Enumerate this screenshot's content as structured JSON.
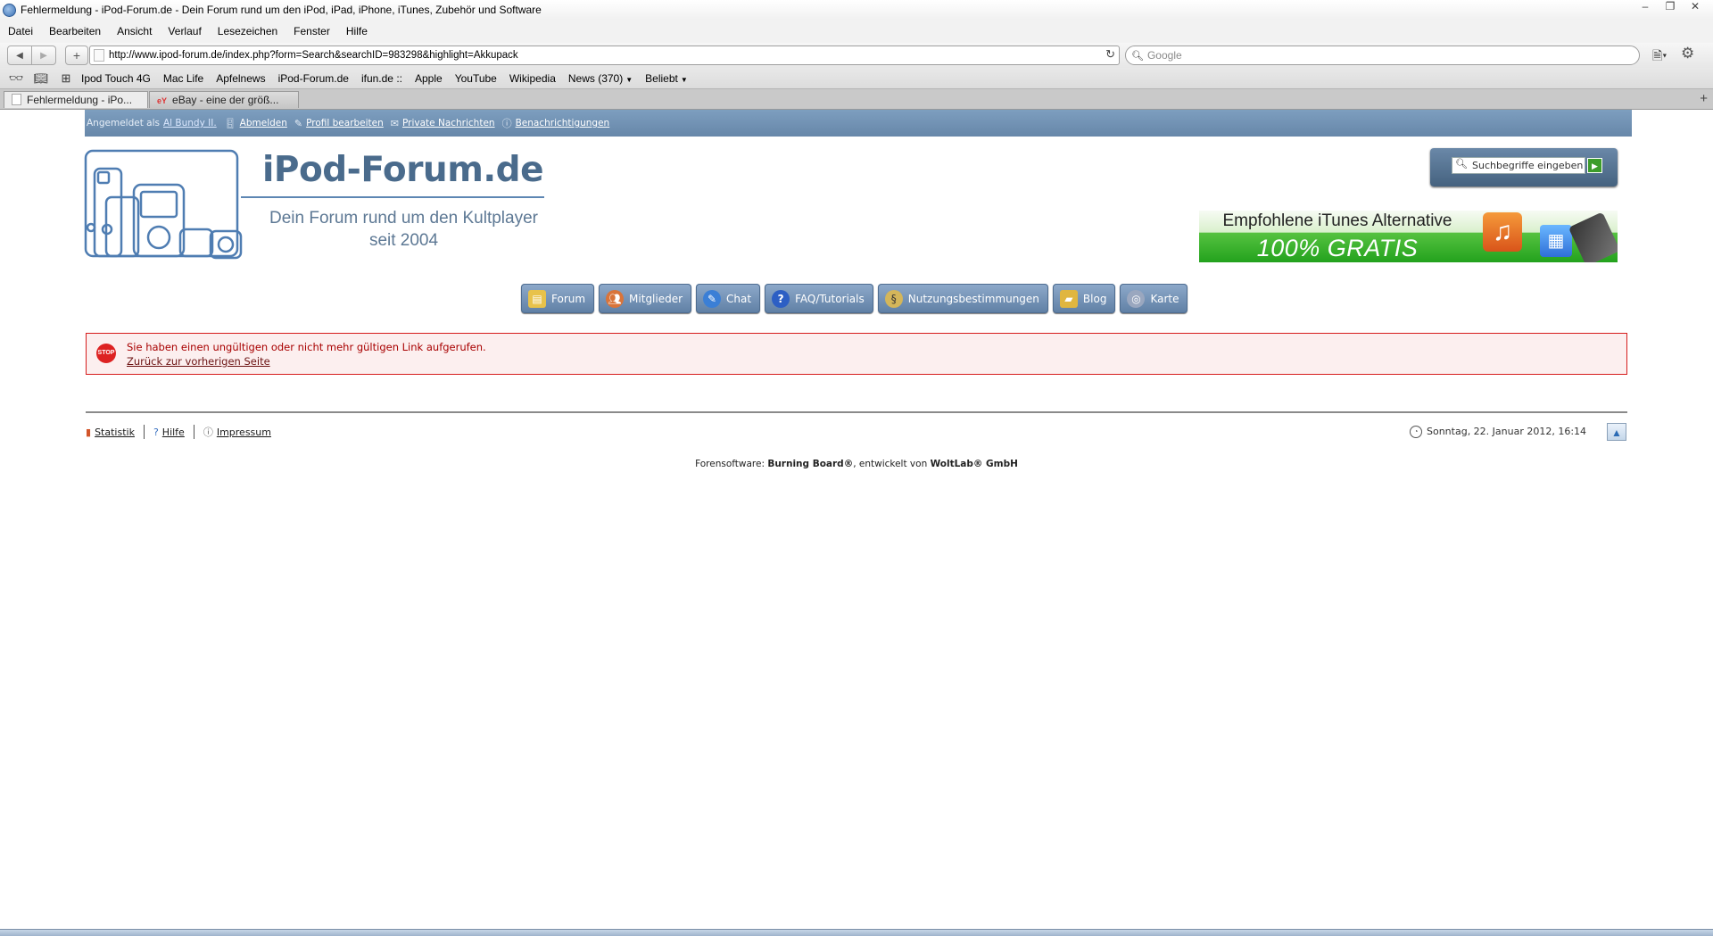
{
  "window": {
    "title": "Fehlermeldung - iPod-Forum.de - Dein Forum rund um den iPod, iPad, iPhone, iTunes, Zubehör und Software",
    "controls": [
      "–",
      "❐",
      "✕"
    ]
  },
  "menubar": [
    "Datei",
    "Bearbeiten",
    "Ansicht",
    "Verlauf",
    "Lesezeichen",
    "Fenster",
    "Hilfe"
  ],
  "navbar": {
    "url": "http://www.ipod-forum.de/index.php?form=Search&searchID=983298&highlight=Akkupack",
    "search_placeholder": "Google"
  },
  "bookmarks": {
    "items": [
      "Ipod Touch 4G",
      "Mac Life",
      "Apfelnews",
      "iPod-Forum.de",
      "ifun.de ::",
      "Apple",
      "YouTube",
      "Wikipedia",
      "News (370)",
      "Beliebt"
    ]
  },
  "tabs": [
    {
      "label": "Fehlermeldung - iPo..."
    },
    {
      "label": "eBay - eine der größ..."
    }
  ],
  "userbar": {
    "prefix": "Angemeldet als",
    "username": "Al Bundy II.",
    "logout": "Abmelden",
    "edit_profile": "Profil bearbeiten",
    "messages": "Private Nachrichten",
    "notifications": "Benachrichtigungen"
  },
  "header": {
    "logo_title": "iPod-Forum.de",
    "tagline_line1": "Dein Forum rund um den Kultplayer",
    "tagline_line2": "seit 2004",
    "search_placeholder": "Suchbegriffe eingeben"
  },
  "ad": {
    "line1": "Empfohlene iTunes Alternative",
    "line2": "100% GRATIS"
  },
  "main_nav": {
    "forum": "Forum",
    "members": "Mitglieder",
    "chat": "Chat",
    "faq": "FAQ/Tutorials",
    "terms": "Nutzungsbestimmungen",
    "blog": "Blog",
    "map": "Karte"
  },
  "error": {
    "icon_text": "STOP",
    "message": "Sie haben einen ungültigen oder nicht mehr gültigen Link aufgerufen.",
    "back_link": "Zurück zur vorherigen Seite"
  },
  "footer": {
    "stats": "Statistik",
    "help": "Hilfe",
    "imprint": "Impressum",
    "datetime": "Sonntag, 22. Januar 2012, 16:14",
    "credits_prefix": "Forensoftware:",
    "credits_product": "Burning Board®",
    "credits_middle": ", entwickelt von",
    "credits_company": "WoltLab® GmbH"
  },
  "colors": {
    "userbar": "#6f8fb1",
    "nav_button": "#6f8db0",
    "error_border": "#d61c1c",
    "error_text": "#a80000",
    "ad_green": "#2ea923"
  }
}
